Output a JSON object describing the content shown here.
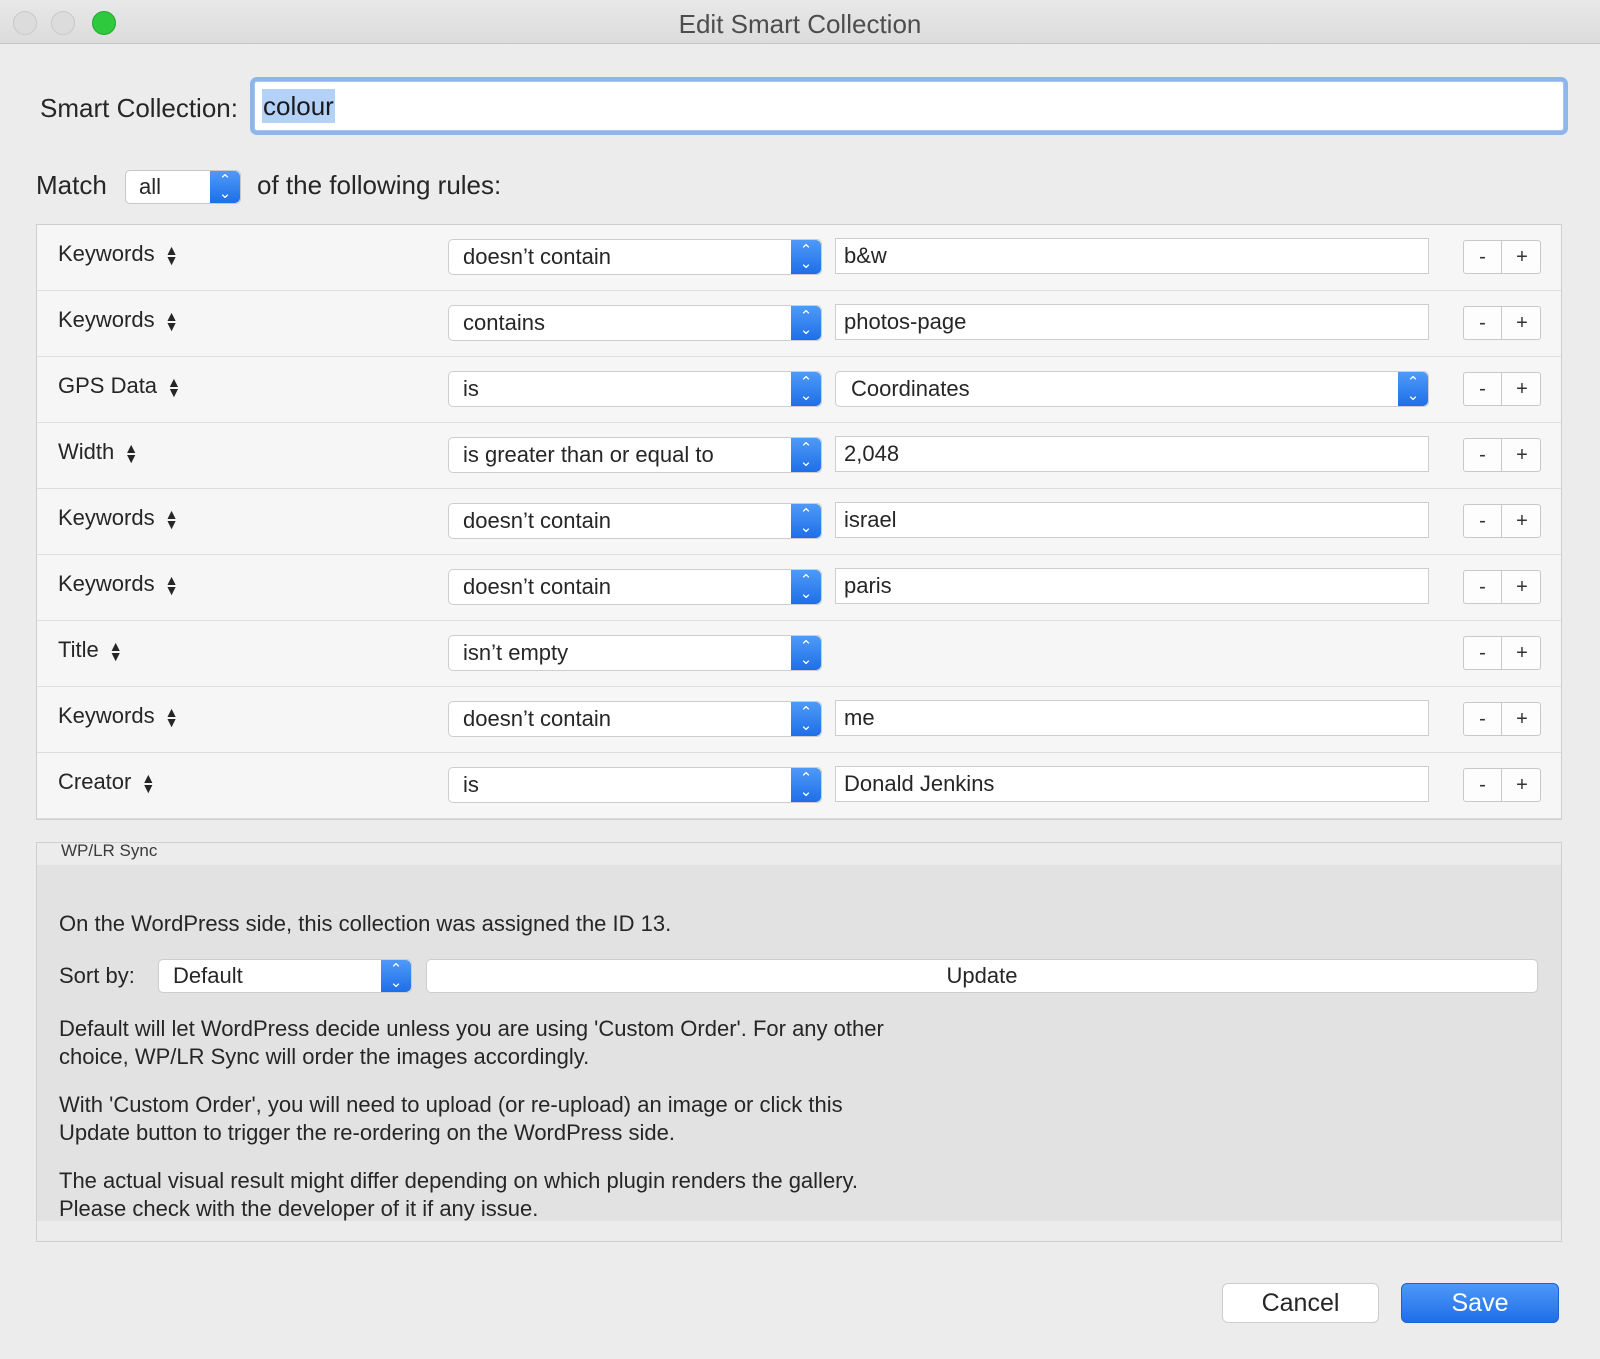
{
  "window": {
    "title": "Edit Smart Collection"
  },
  "name_row": {
    "label": "Smart Collection:",
    "value": "colour"
  },
  "match_row": {
    "prefix": "Match",
    "value": "all",
    "suffix": "of the following rules:"
  },
  "rules": [
    {
      "field": "Keywords",
      "operator": "doesn’t contain",
      "value": "b&w",
      "value_type": "text"
    },
    {
      "field": "Keywords",
      "operator": "contains",
      "value": "photos-page",
      "value_type": "text"
    },
    {
      "field": "GPS Data",
      "operator": "is",
      "value": "Coordinates",
      "value_type": "select"
    },
    {
      "field": "Width",
      "operator": "is greater than or equal to",
      "value": "2,048",
      "value_type": "text"
    },
    {
      "field": "Keywords",
      "operator": "doesn’t contain",
      "value": "israel",
      "value_type": "text"
    },
    {
      "field": "Keywords",
      "operator": "doesn’t contain",
      "value": "paris",
      "value_type": "text"
    },
    {
      "field": "Title",
      "operator": "isn’t empty",
      "value": "",
      "value_type": "none"
    },
    {
      "field": "Keywords",
      "operator": "doesn’t contain",
      "value": "me",
      "value_type": "text"
    },
    {
      "field": "Creator",
      "operator": "is",
      "value": "Donald Jenkins",
      "value_type": "text"
    }
  ],
  "rule_buttons": {
    "minus": "-",
    "plus": "+"
  },
  "sync": {
    "legend": "WP/LR Sync",
    "id_text": "On the WordPress side, this collection was assigned the ID 13.",
    "sort_label": "Sort by:",
    "sort_value": "Default",
    "update_label": "Update",
    "help1": "Default will let WordPress decide unless you are using 'Custom Order'. For any other choice, WP/LR Sync will order the images accordingly.",
    "help2": "With 'Custom Order', you will need to upload (or re-upload) an image or click this Update button to trigger the re-ordering on the WordPress side.",
    "help3": "The actual visual result might differ depending on which plugin renders the gallery. Please check with the developer of it if any issue."
  },
  "footer": {
    "cancel_label": "Cancel",
    "save_label": "Save"
  },
  "colors": {
    "accent": "#1f6ee8",
    "focus_ring": "#8fb6ec",
    "zoom_button": "#2ec93d"
  }
}
